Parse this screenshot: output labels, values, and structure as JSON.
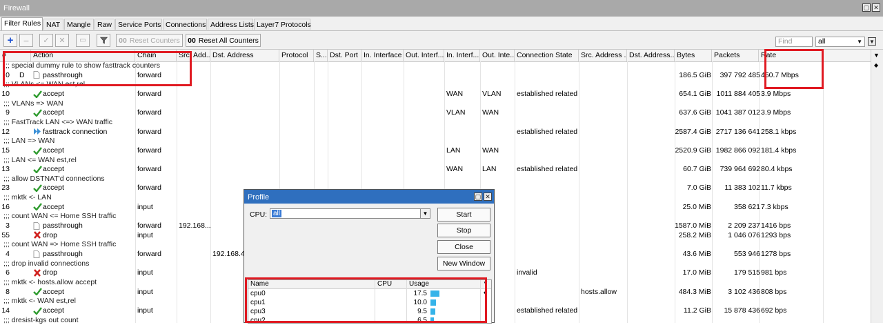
{
  "window": {
    "title": "Firewall"
  },
  "tabs": [
    "Filter Rules",
    "NAT",
    "Mangle",
    "Raw",
    "Service Ports",
    "Connections",
    "Address Lists",
    "Layer7 Protocols"
  ],
  "toolbar": {
    "reset_counters": "Reset Counters",
    "reset_all_counters": "Reset All Counters",
    "reset_prefix": "00",
    "search_placeholder": "Find",
    "filter_value": "all"
  },
  "columns": [
    "#",
    "Action",
    "Chain",
    "Src. Add...",
    "Dst. Address",
    "Protocol",
    "S...",
    "Dst. Port",
    "In. Interface",
    "Out. Interf...",
    "In. Interf...",
    "Out. Inte...",
    "Connection State",
    "Src. Address ...",
    "Dst. Address...",
    "Bytes",
    "Packets",
    "Rate"
  ],
  "rows": [
    {
      "type": "comment",
      "text": ";;; special dummy rule to show fasttrack counters"
    },
    {
      "type": "rule",
      "num": "0",
      "flag": "D",
      "icon": "passthrough",
      "action": "passthrough",
      "chain": "forward",
      "bytes": "186.5 GiB",
      "packets": "397 792 485",
      "rate": "450.7 Mbps"
    },
    {
      "type": "comment",
      "text": ";;; VLANs <= WAN est,rel"
    },
    {
      "type": "rule",
      "num": "10",
      "icon": "accept",
      "action": "accept",
      "chain": "forward",
      "in_iface_list": "WAN",
      "out_iface_list": "VLAN",
      "conn_state": "established related",
      "bytes": "654.1 GiB",
      "packets": "1011 884 405",
      "rate": "3.9 Mbps"
    },
    {
      "type": "comment",
      "text": ";;; VLANs => WAN"
    },
    {
      "type": "rule",
      "num": "9",
      "icon": "accept",
      "action": "accept",
      "chain": "forward",
      "in_iface_list": "VLAN",
      "out_iface_list": "WAN",
      "bytes": "637.6 GiB",
      "packets": "1041 387 012",
      "rate": "3.9 Mbps"
    },
    {
      "type": "comment",
      "text": ";;; FastTrack LAN <=> WAN traffic"
    },
    {
      "type": "rule",
      "num": "12",
      "icon": "fasttrack",
      "action": "fasttrack connection",
      "chain": "forward",
      "conn_state": "established related",
      "bytes": "2587.4 GiB",
      "packets": "2717 136 641",
      "rate": "258.1 kbps"
    },
    {
      "type": "comment",
      "text": ";;; LAN => WAN"
    },
    {
      "type": "rule",
      "num": "15",
      "icon": "accept",
      "action": "accept",
      "chain": "forward",
      "in_iface_list": "LAN",
      "out_iface_list": "WAN",
      "bytes": "2520.9 GiB",
      "packets": "1982 866 092",
      "rate": "181.4 kbps"
    },
    {
      "type": "comment",
      "text": ";;; LAN <= WAN est,rel"
    },
    {
      "type": "rule",
      "num": "13",
      "icon": "accept",
      "action": "accept",
      "chain": "forward",
      "in_iface_list": "WAN",
      "out_iface_list": "LAN",
      "conn_state": "established related",
      "bytes": "60.7 GiB",
      "packets": "739 964 692",
      "rate": "80.4 kbps"
    },
    {
      "type": "comment",
      "text": ";;; allow DSTNAT'd connections"
    },
    {
      "type": "rule",
      "num": "23",
      "icon": "accept",
      "action": "accept",
      "chain": "forward",
      "bytes": "7.0 GiB",
      "packets": "11 383 102",
      "rate": "11.7 kbps"
    },
    {
      "type": "comment",
      "text": ";;; mktk <- LAN"
    },
    {
      "type": "rule",
      "num": "16",
      "icon": "accept",
      "action": "accept",
      "chain": "input",
      "bytes": "25.0 MiB",
      "packets": "358 621",
      "rate": "7.3 kbps"
    },
    {
      "type": "comment",
      "text": ";;; count WAN <= Home SSH traffic"
    },
    {
      "type": "rule",
      "num": "3",
      "icon": "passthrough",
      "action": "passthrough",
      "chain": "forward",
      "src": "192.168...",
      "bytes": "1587.0 MiB",
      "packets": "2 209 237",
      "rate": "1416 bps"
    },
    {
      "type": "rule",
      "num": "55",
      "icon": "drop",
      "action": "drop",
      "chain": "input",
      "bytes": "258.2 MiB",
      "packets": "1 046 076",
      "rate": "1293 bps"
    },
    {
      "type": "comment",
      "text": ";;; count WAN => Home SSH traffic"
    },
    {
      "type": "rule",
      "num": "4",
      "icon": "passthrough",
      "action": "passthrough",
      "chain": "forward",
      "dst": "192.168.4",
      "bytes": "43.6 MiB",
      "packets": "553 946",
      "rate": "1278 bps"
    },
    {
      "type": "comment",
      "text": ";;; drop invalid connections"
    },
    {
      "type": "rule",
      "num": "6",
      "icon": "drop",
      "action": "drop",
      "chain": "input",
      "conn_state": "invalid",
      "bytes": "17.0 MiB",
      "packets": "179 515",
      "rate": "981 bps"
    },
    {
      "type": "comment",
      "text": ";;; mktk <- hosts.allow accept"
    },
    {
      "type": "rule",
      "num": "8",
      "icon": "accept",
      "action": "accept",
      "chain": "input",
      "src_list": "hosts.allow",
      "bytes": "484.3 MiB",
      "packets": "3 102 436",
      "rate": "808 bps"
    },
    {
      "type": "comment",
      "text": ";;; mktk <- WAN est,rel"
    },
    {
      "type": "rule",
      "num": "14",
      "icon": "accept",
      "action": "accept",
      "chain": "input",
      "conn_state": "established related",
      "bytes": "11.2 GiB",
      "packets": "15 878 436",
      "rate": "692 bps"
    },
    {
      "type": "comment",
      "text": ";;; dresist-kgs out count"
    }
  ],
  "profile": {
    "title": "Profile",
    "cpu_label": "CPU:",
    "cpu_value": "all",
    "buttons": [
      "Start",
      "Stop",
      "Close",
      "New Window"
    ],
    "columns": [
      "Name",
      "CPU",
      "Usage"
    ],
    "rows": [
      {
        "name": "cpu0",
        "cpu": "",
        "usage": "17.5",
        "level": 0.175
      },
      {
        "name": "cpu1",
        "cpu": "",
        "usage": "10.0",
        "level": 0.1
      },
      {
        "name": "cpu3",
        "cpu": "",
        "usage": "9.5",
        "level": 0.095
      },
      {
        "name": "cpu2",
        "cpu": "",
        "usage": "6.5",
        "level": 0.065
      }
    ]
  },
  "colors": {
    "accent": "#2f6fbe",
    "highlight": "#e01a22",
    "accept": "#2e9b2e",
    "drop": "#d0201d",
    "fasttrack": "#3a8fd6"
  }
}
